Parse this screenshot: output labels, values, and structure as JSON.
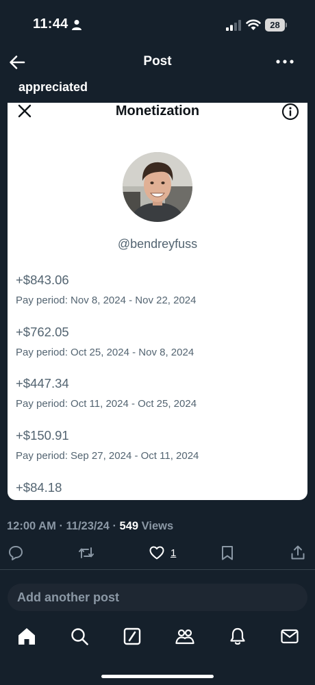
{
  "status_bar": {
    "time": "11:44",
    "battery": "28"
  },
  "header": {
    "title": "Post"
  },
  "post": {
    "text_fragment": "appreciated"
  },
  "card": {
    "title": "Monetization",
    "handle": "@bendreyfuss",
    "payouts": [
      {
        "amount": "+$843.06",
        "period": "Pay period: Nov 8, 2024 - Nov 22, 2024"
      },
      {
        "amount": "+$762.05",
        "period": "Pay period: Oct 25, 2024 - Nov 8, 2024"
      },
      {
        "amount": "+$447.34",
        "period": "Pay period: Oct 11, 2024 - Oct 25, 2024"
      },
      {
        "amount": "+$150.91",
        "period": "Pay period: Sep 27, 2024 - Oct 11, 2024"
      },
      {
        "amount": "+$84.18",
        "period": ""
      }
    ]
  },
  "meta": {
    "time": "12:00 AM",
    "date": "11/23/24",
    "views_count": "549",
    "views_label": "Views"
  },
  "actions": {
    "like_count": "1"
  },
  "composer": {
    "placeholder": "Add another post"
  },
  "icons": {
    "header": [
      "back-arrow-icon",
      "more-icon"
    ],
    "card": [
      "close-icon",
      "info-icon"
    ],
    "actions": [
      "reply-icon",
      "repost-icon",
      "like-icon",
      "bookmark-icon",
      "share-icon"
    ],
    "tabs": [
      "home-icon",
      "search-icon",
      "grok-icon",
      "communities-icon",
      "notifications-icon",
      "messages-icon"
    ]
  }
}
